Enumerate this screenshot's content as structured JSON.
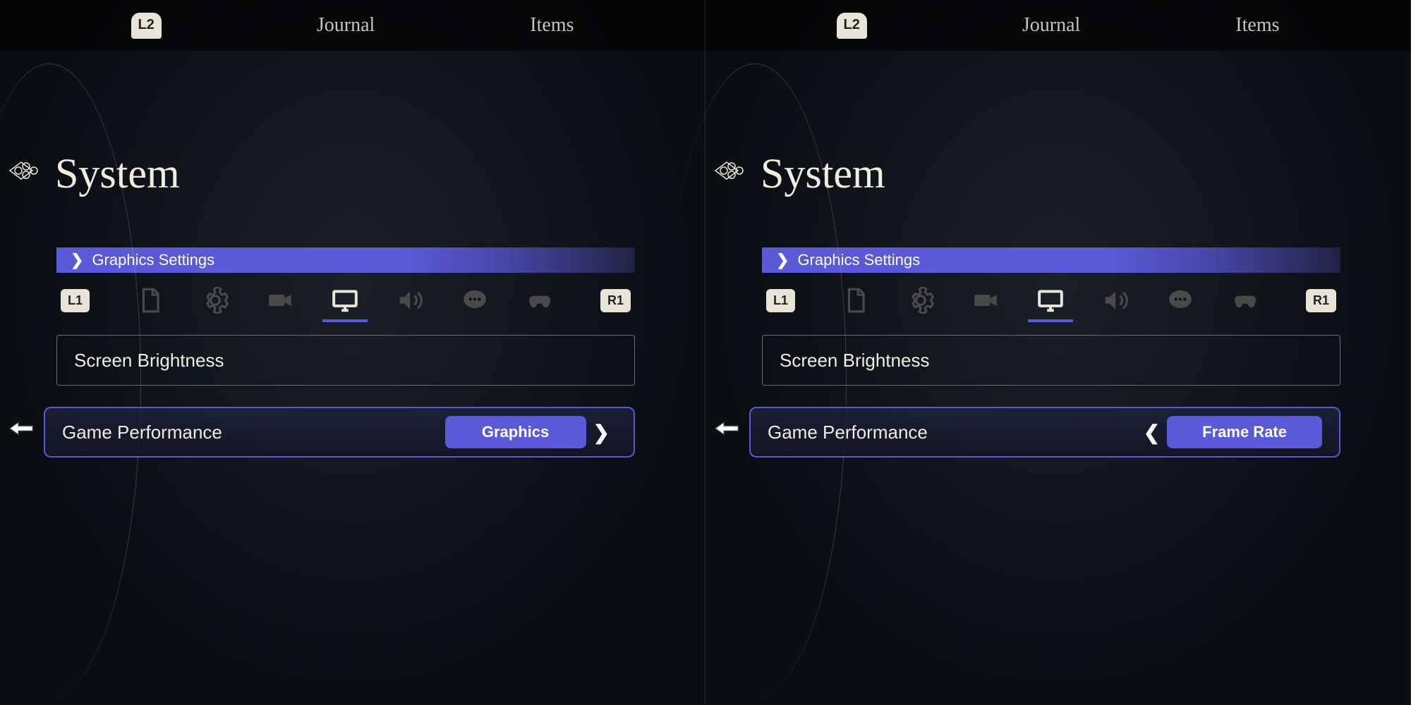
{
  "panels": [
    {
      "topbar": {
        "bumper": "L2",
        "nav1": "Journal",
        "nav2": "Items"
      },
      "title": "System",
      "section_label": "Graphics Settings",
      "shoulders": {
        "left": "L1",
        "right": "R1"
      },
      "option_brightness": "Screen Brightness",
      "option_performance": "Game Performance",
      "performance_value": "Graphics",
      "arrow_side": "right"
    },
    {
      "topbar": {
        "bumper": "L2",
        "nav1": "Journal",
        "nav2": "Items"
      },
      "title": "System",
      "section_label": "Graphics Settings",
      "shoulders": {
        "left": "L1",
        "right": "R1"
      },
      "option_brightness": "Screen Brightness",
      "option_performance": "Game Performance",
      "performance_value": "Frame Rate",
      "arrow_side": "left"
    }
  ],
  "icons": {
    "tabs": [
      "document",
      "gear",
      "camera",
      "display",
      "sound",
      "chat",
      "controller"
    ]
  }
}
